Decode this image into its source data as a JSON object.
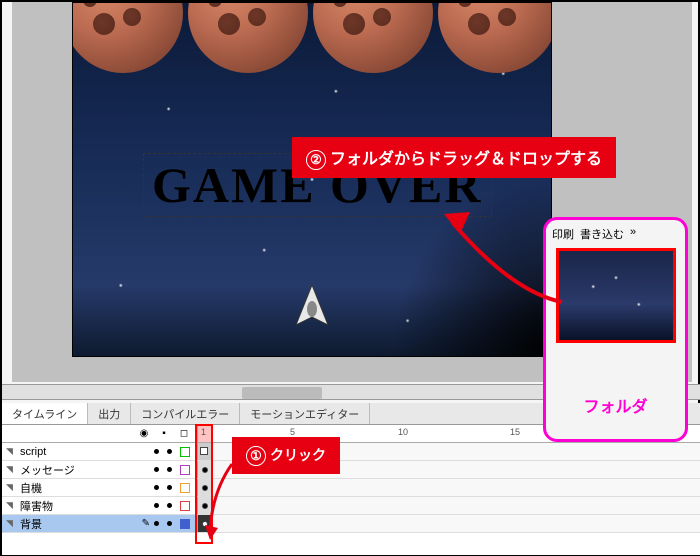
{
  "stage": {
    "gameover_text": "GAME OVER"
  },
  "tabs": {
    "timeline": "タイムライン",
    "output": "出力",
    "compile_error": "コンパイルエラー",
    "motion_editor": "モーションエディター"
  },
  "timeline": {
    "head_icons": {
      "eye": "👁",
      "lock": "🔒",
      "outline": "◻"
    },
    "ruler": {
      "m1": "1",
      "m5": "5",
      "m10": "10",
      "m15": "15"
    },
    "layers": [
      {
        "name": "script",
        "color": "#00c000"
      },
      {
        "name": "メッセージ",
        "color": "#b040c0"
      },
      {
        "name": "自機",
        "color": "#f0a030"
      },
      {
        "name": "障害物",
        "color": "#e04040"
      },
      {
        "name": "背景",
        "color": "#4060d0"
      }
    ]
  },
  "callouts": {
    "drag_num": "②",
    "drag_text": "フォルダからドラッグ＆ドロップする",
    "click_num": "①",
    "click_text": "クリック"
  },
  "folder_panel": {
    "print": "印刷",
    "write": "書き込む",
    "more": "»",
    "label": "フォルダ"
  }
}
